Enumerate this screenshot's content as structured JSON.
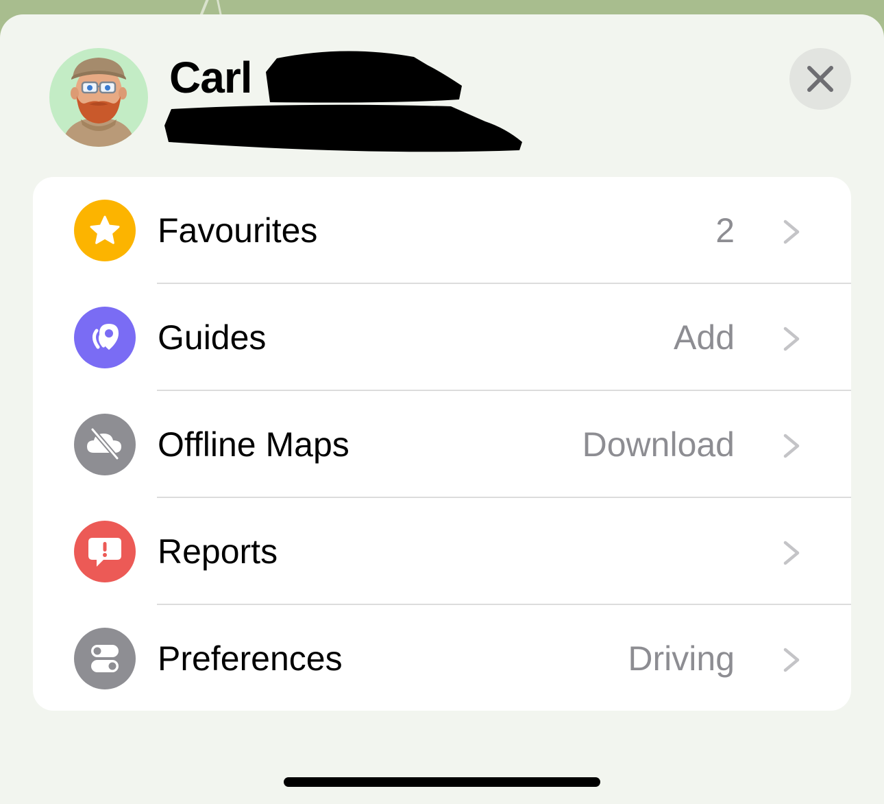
{
  "profile": {
    "name": "Carl",
    "avatar_icon": "memoji-avatar"
  },
  "header": {
    "close_icon": "close-icon"
  },
  "menu": {
    "items": [
      {
        "label": "Favourites",
        "value": "2",
        "icon": "star-icon",
        "color": "#fcb400"
      },
      {
        "label": "Guides",
        "value": "Add",
        "icon": "guides-icon",
        "color": "#7a6cf4"
      },
      {
        "label": "Offline Maps",
        "value": "Download",
        "icon": "cloud-slash-icon",
        "color": "#8e8e93"
      },
      {
        "label": "Reports",
        "value": "",
        "icon": "report-bubble-icon",
        "color": "#ec5a56"
      },
      {
        "label": "Preferences",
        "value": "Driving",
        "icon": "toggles-icon",
        "color": "#8e8e93"
      }
    ]
  },
  "colors": {
    "sheet_background": "#f2f5ef",
    "card_background": "#ffffff",
    "secondary_text": "#8d8d92"
  }
}
